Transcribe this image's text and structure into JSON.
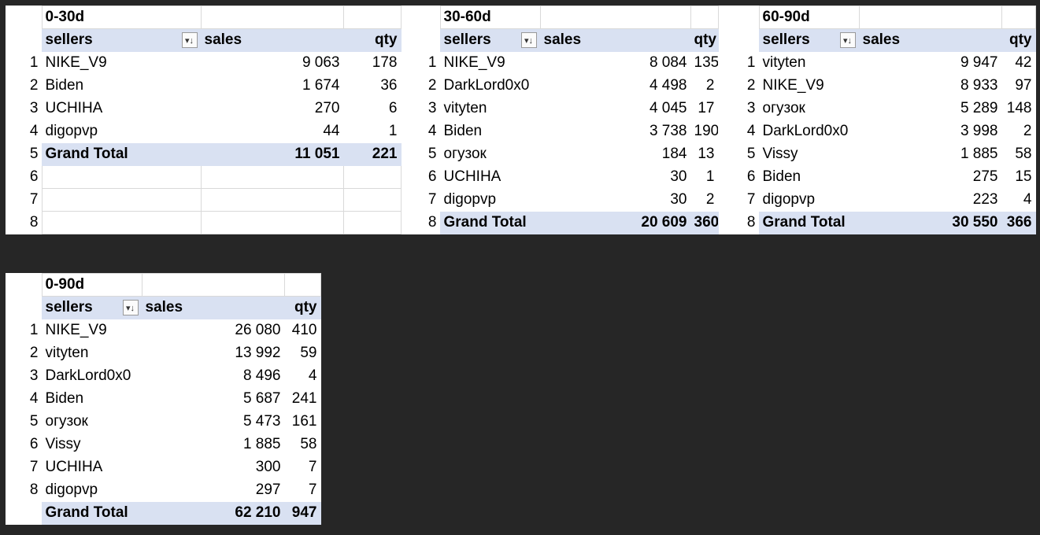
{
  "tables": [
    {
      "period": "0-30d",
      "headers": {
        "sellers": "sellers",
        "sales": "sales",
        "qty": "qty"
      },
      "filter_icon": "sort-filter-icon",
      "rows": [
        {
          "n": "1",
          "seller": "NIKE_V9",
          "sales": "9 063",
          "qty": "178"
        },
        {
          "n": "2",
          "seller": "Biden",
          "sales": "1 674",
          "qty": "36"
        },
        {
          "n": "3",
          "seller": "UCHIHA",
          "sales": "270",
          "qty": "6"
        },
        {
          "n": "4",
          "seller": "digopvp",
          "sales": "44",
          "qty": "1"
        }
      ],
      "total": {
        "n": "5",
        "label": "Grand Total",
        "sales": "11 051",
        "qty": "221"
      },
      "empty_rows": [
        "6",
        "7",
        "8"
      ]
    },
    {
      "period": "30-60d",
      "headers": {
        "sellers": "sellers",
        "sales": "sales",
        "qty": "qty"
      },
      "filter_icon": "sort-filter-icon",
      "rows": [
        {
          "n": "1",
          "seller": "NIKE_V9",
          "sales": "8 084",
          "qty": "135"
        },
        {
          "n": "2",
          "seller": "DarkLord0x0",
          "sales": "4 498",
          "qty": "2"
        },
        {
          "n": "3",
          "seller": "vityten",
          "sales": "4 045",
          "qty": "17"
        },
        {
          "n": "4",
          "seller": "Biden",
          "sales": "3 738",
          "qty": "190"
        },
        {
          "n": "5",
          "seller": "огузок",
          "sales": "184",
          "qty": "13"
        },
        {
          "n": "6",
          "seller": "UCHIHA",
          "sales": "30",
          "qty": "1"
        },
        {
          "n": "7",
          "seller": "digopvp",
          "sales": "30",
          "qty": "2"
        }
      ],
      "total": {
        "n": "8",
        "label": "Grand Total",
        "sales": "20 609",
        "qty": "360"
      },
      "empty_rows": []
    },
    {
      "period": "60-90d",
      "headers": {
        "sellers": "sellers",
        "sales": "sales",
        "qty": "qty"
      },
      "filter_icon": "sort-filter-icon",
      "rows": [
        {
          "n": "1",
          "seller": "vityten",
          "sales": "9 947",
          "qty": "42"
        },
        {
          "n": "2",
          "seller": "NIKE_V9",
          "sales": "8 933",
          "qty": "97"
        },
        {
          "n": "3",
          "seller": "огузок",
          "sales": "5 289",
          "qty": "148"
        },
        {
          "n": "4",
          "seller": "DarkLord0x0",
          "sales": "3 998",
          "qty": "2"
        },
        {
          "n": "5",
          "seller": "Vissy",
          "sales": "1 885",
          "qty": "58"
        },
        {
          "n": "6",
          "seller": "Biden",
          "sales": "275",
          "qty": "15"
        },
        {
          "n": "7",
          "seller": "digopvp",
          "sales": "223",
          "qty": "4"
        }
      ],
      "total": {
        "n": "8",
        "label": "Grand Total",
        "sales": "30 550",
        "qty": "366"
      },
      "empty_rows": []
    },
    {
      "period": "0-90d",
      "headers": {
        "sellers": "sellers",
        "sales": "sales",
        "qty": "qty"
      },
      "filter_icon": "sort-filter-icon",
      "rows": [
        {
          "n": "1",
          "seller": "NIKE_V9",
          "sales": "26 080",
          "qty": "410"
        },
        {
          "n": "2",
          "seller": "vityten",
          "sales": "13 992",
          "qty": "59"
        },
        {
          "n": "3",
          "seller": "DarkLord0x0",
          "sales": "8 496",
          "qty": "4"
        },
        {
          "n": "4",
          "seller": "Biden",
          "sales": "5 687",
          "qty": "241"
        },
        {
          "n": "5",
          "seller": "огузок",
          "sales": "5 473",
          "qty": "161"
        },
        {
          "n": "6",
          "seller": "Vissy",
          "sales": "1 885",
          "qty": "58"
        },
        {
          "n": "7",
          "seller": "UCHIHA",
          "sales": "300",
          "qty": "7"
        },
        {
          "n": "8",
          "seller": "digopvp",
          "sales": "297",
          "qty": "7"
        }
      ],
      "total": {
        "n": "",
        "label": "Grand Total",
        "sales": "62 210",
        "qty": "947"
      },
      "empty_rows": []
    }
  ],
  "colors": {
    "background": "#262626",
    "header_fill": "#d9e1f2",
    "cell_fill": "#ffffff",
    "gridline": "#d9d9d9"
  }
}
